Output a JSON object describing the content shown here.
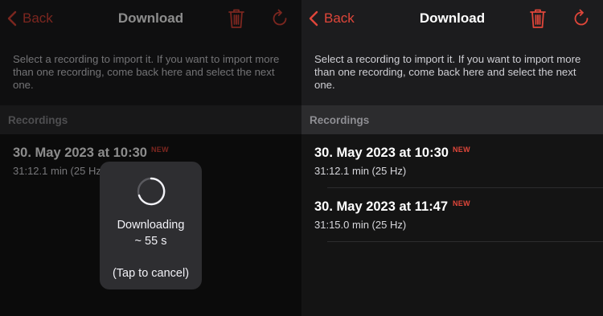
{
  "left": {
    "nav": {
      "back_label": "Back",
      "title": "Download"
    },
    "description": "Select a recording to import it. If you want to import more than one recording, come back here and select the next one.",
    "section_header": "Recordings",
    "recordings": [
      {
        "title": "30. May 2023 at 10:30",
        "badge": "NEW",
        "subtitle": "31:12.1 min (25 Hz)"
      }
    ],
    "hud": {
      "line1": "Downloading",
      "line2": "~ 55 s",
      "cancel": "(Tap to cancel)"
    }
  },
  "right": {
    "nav": {
      "back_label": "Back",
      "title": "Download"
    },
    "description": "Select a recording to import it. If you want to import more than one recording, come back here and select the next one.",
    "section_header": "Recordings",
    "recordings": [
      {
        "title": "30. May 2023 at 10:30",
        "badge": "NEW",
        "subtitle": "31:12.1 min (25 Hz)"
      },
      {
        "title": "30. May 2023 at 11:47",
        "badge": "NEW",
        "subtitle": "31:15.0 min (25 Hz)"
      }
    ]
  },
  "colors": {
    "accent": "#e0463a",
    "background": "#1c1c1e",
    "section": "#2c2c2e"
  },
  "icons": [
    "chevron-left-icon",
    "trash-icon",
    "refresh-icon",
    "spinner-icon"
  ]
}
